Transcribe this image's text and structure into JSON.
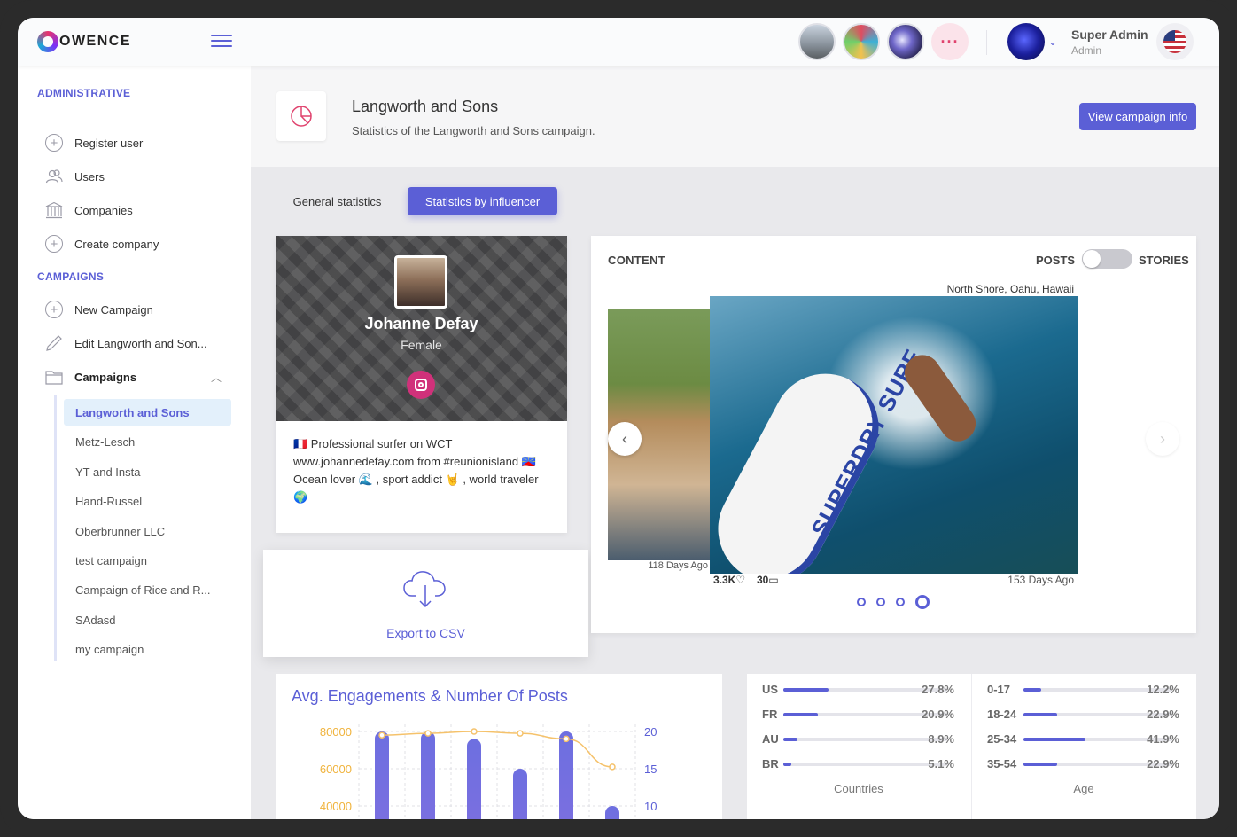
{
  "brand": {
    "name": "OWENCE"
  },
  "header": {
    "user_name": "Super Admin",
    "user_role": "Admin",
    "more_label": "···"
  },
  "sidebar": {
    "section_admin": "ADMINISTRATIVE",
    "admin_items": [
      {
        "label": "Register user",
        "icon": "plus-circle-icon"
      },
      {
        "label": "Users",
        "icon": "users-icon"
      },
      {
        "label": "Companies",
        "icon": "building-icon"
      },
      {
        "label": "Create company",
        "icon": "plus-circle-icon"
      }
    ],
    "section_campaigns": "CAMPAIGNS",
    "campaign_items": [
      {
        "label": "New Campaign",
        "icon": "plus-circle-icon"
      },
      {
        "label": "Edit Langworth and Son...",
        "icon": "pencil-icon"
      },
      {
        "label": "Campaigns",
        "icon": "folder-icon"
      }
    ],
    "campaign_list": [
      "Langworth and Sons",
      "Metz-Lesch",
      "YT and Insta",
      "Hand-Russel",
      "Oberbrunner LLC",
      "test campaign",
      "Campaign of Rice and R...",
      "SAdasd",
      "my campaign"
    ]
  },
  "page": {
    "title": "Langworth and Sons",
    "subtitle": "Statistics of the Langworth and Sons campaign.",
    "view_button": "View campaign info"
  },
  "tabs": {
    "general": "General statistics",
    "influencer": "Statistics by influencer"
  },
  "profile": {
    "name": "Johanne Defay",
    "gender": "Female",
    "bio": "🇫🇷 Professional surfer on WCT www.johannedefay.com from #reunionisland 🇷🇪 Ocean lover 🌊 , sport addict 🤘 , world traveler 🌍"
  },
  "export": {
    "label": "Export to CSV"
  },
  "content": {
    "title": "CONTENT",
    "toggle_left": "POSTS",
    "toggle_right": "STORIES",
    "toggle_state": "posts",
    "location": "North Shore, Oahu, Hawaii",
    "board_text": "SUPERDRY SURF",
    "prev_caption": "118 Days Ago",
    "likes": "3.3K",
    "comments": "30",
    "days": "153 Days Ago",
    "dots_count": 4,
    "active_dot": 4
  },
  "chart_data": {
    "type": "bar",
    "title": "Avg. Engagements & Number Of Posts",
    "y_left_ticks": [
      "80000",
      "60000",
      "40000"
    ],
    "y_right_ticks": [
      "20",
      "15",
      "10"
    ],
    "series": [
      {
        "values": [
          20,
          20,
          19,
          15,
          20,
          10
        ]
      },
      {
        "values": [
          78000,
          79000,
          80000,
          79000,
          76000,
          61000
        ]
      }
    ],
    "colors": {
      "bar": "#6d6fe0",
      "line": "#f5c26b",
      "left_axis": "#f0b33c",
      "right_axis": "#5b5fd6"
    }
  },
  "stats": {
    "countries": {
      "caption": "Countries",
      "rows": [
        {
          "label": "US",
          "value": "27.8%",
          "pct": 27.8
        },
        {
          "label": "FR",
          "value": "20.9%",
          "pct": 20.9
        },
        {
          "label": "AU",
          "value": "8.9%",
          "pct": 8.9
        },
        {
          "label": "BR",
          "value": "5.1%",
          "pct": 5.1
        }
      ]
    },
    "age": {
      "caption": "Age",
      "rows": [
        {
          "label": "0-17",
          "value": "12.2%",
          "pct": 12.2
        },
        {
          "label": "18-24",
          "value": "22.9%",
          "pct": 22.9
        },
        {
          "label": "25-34",
          "value": "41.9%",
          "pct": 41.9
        },
        {
          "label": "35-54",
          "value": "22.9%",
          "pct": 22.9
        }
      ]
    }
  }
}
